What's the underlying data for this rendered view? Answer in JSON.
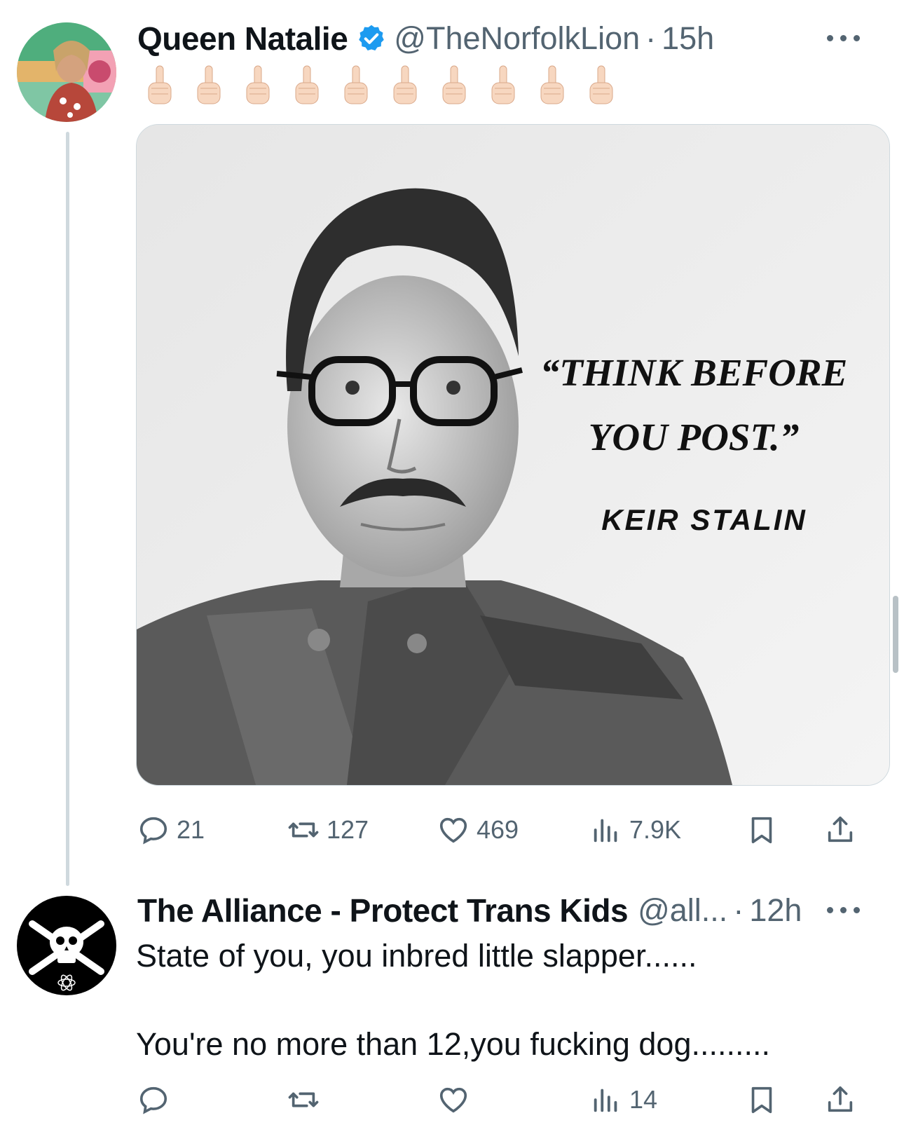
{
  "tweet": {
    "author_name": "Queen Natalie",
    "handle": "@TheNorfolkLion",
    "separator": "·",
    "time": "15h",
    "emoji_text": "🖕🏻🖕🏻🖕🏻🖕🏻🖕🏻🖕🏻🖕🏻🖕🏻🖕🏻🖕🏻",
    "media": {
      "quote_line1": "“THINK BEFORE",
      "quote_line2": "YOU POST.”",
      "attribution": "KEIR STALIN"
    },
    "stats": {
      "replies": "21",
      "reposts": "127",
      "likes": "469",
      "views": "7.9K"
    }
  },
  "reply": {
    "author_name": "The Alliance - Protect Trans Kids",
    "handle": "@all...",
    "separator": "·",
    "time": "12h",
    "line1": "State of you, you inbred little slapper......",
    "line2": "You're no more than 12,you fucking dog.........",
    "stats": {
      "views": "14"
    }
  },
  "colors": {
    "text": "#0f1419",
    "secondary": "#536471",
    "verified": "#1d9bf0",
    "border": "#cfd9de"
  },
  "icons": [
    "more-icon",
    "verified-badge-icon",
    "middle-finger-emoji-icon",
    "reply-icon",
    "repost-icon",
    "like-icon",
    "views-icon",
    "bookmark-icon",
    "share-icon"
  ]
}
